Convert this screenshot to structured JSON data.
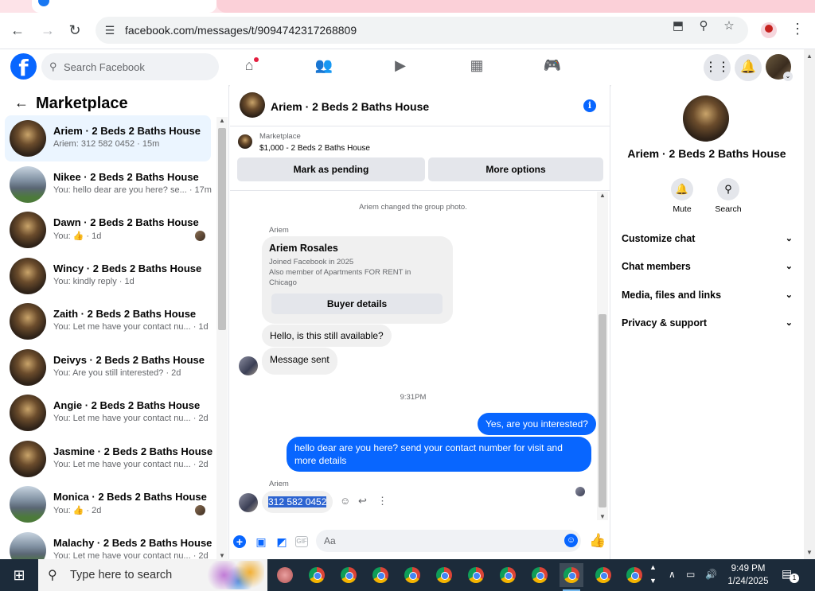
{
  "browser": {
    "url": "facebook.com/messages/t/9094742317268809"
  },
  "header": {
    "search_placeholder": "Search Facebook"
  },
  "left": {
    "title": "Marketplace",
    "conversations": [
      {
        "name": "Ariem · 2 Beds 2 Baths House",
        "preview": "Ariem: 312 582 0452 · 15m",
        "thumb": "room",
        "active": true,
        "seen": false
      },
      {
        "name": "Nikee · 2 Beds 2 Baths House",
        "preview": "You: hello dear are you here? se... · 17m",
        "thumb": "house",
        "active": false,
        "seen": false
      },
      {
        "name": "Dawn · 2 Beds 2 Baths House",
        "preview": "You: 👍 · 1d",
        "thumb": "room",
        "active": false,
        "seen": true
      },
      {
        "name": "Wincy · 2 Beds 2 Baths House",
        "preview": "You: kindly reply · 1d",
        "thumb": "room",
        "active": false,
        "seen": false
      },
      {
        "name": "Zaith · 2 Beds 2 Baths House",
        "preview": "You: Let me have your contact nu... · 1d",
        "thumb": "room",
        "active": false,
        "seen": false
      },
      {
        "name": "Deivys · 2 Beds 2 Baths House",
        "preview": "You: Are you still interested? · 2d",
        "thumb": "room",
        "active": false,
        "seen": false
      },
      {
        "name": "Angie · 2 Beds 2 Baths House",
        "preview": "You: Let me have your contact nu... · 2d",
        "thumb": "room",
        "active": false,
        "seen": false
      },
      {
        "name": "Jasmine · 2 Beds 2 Baths House",
        "preview": "You: Let me have your contact nu... · 2d",
        "thumb": "room",
        "active": false,
        "seen": false
      },
      {
        "name": "Monica · 2 Beds 2 Baths House",
        "preview": "You: 👍 · 2d",
        "thumb": "house",
        "active": false,
        "seen": true
      },
      {
        "name": "Malachy · 2 Beds 2 Baths House",
        "preview": "You: Let me have your contact nu... · 2d",
        "thumb": "house",
        "active": false,
        "seen": false
      }
    ]
  },
  "chat": {
    "title": "Ariem · 2 Beds 2 Baths House",
    "banner_label": "Marketplace",
    "banner_price": "$1,000 - 2 Beds 2 Baths House",
    "mark_pending": "Mark as pending",
    "more_options": "More options",
    "system_msg": "Ariem changed the group photo.",
    "sender_1": "Ariem",
    "card_name": "Ariem Rosales",
    "card_line1": "Joined Facebook in 2025",
    "card_line2": "Also member of Apartments FOR RENT in",
    "card_line3": "Chicago",
    "card_btn": "Buyer details",
    "msg_in_1": "Hello, is this still available?",
    "msg_in_2": "Message sent",
    "time_sep": "9:31PM",
    "msg_out_1": "Yes, are you interested?",
    "msg_out_2": "hello dear are you here? send your contact number for visit and more details",
    "sender_2": "Ariem",
    "msg_in_3": "312 582 0452",
    "composer_placeholder": "Aa"
  },
  "details": {
    "title": "Ariem · 2 Beds 2 Baths House",
    "mute": "Mute",
    "search": "Search",
    "rows": [
      "Customize chat",
      "Chat members",
      "Media, files and links",
      "Privacy & support"
    ]
  },
  "taskbar": {
    "search_text": "Type here to search",
    "time": "9:49 PM",
    "date": "1/24/2025",
    "notif_count": "1"
  }
}
